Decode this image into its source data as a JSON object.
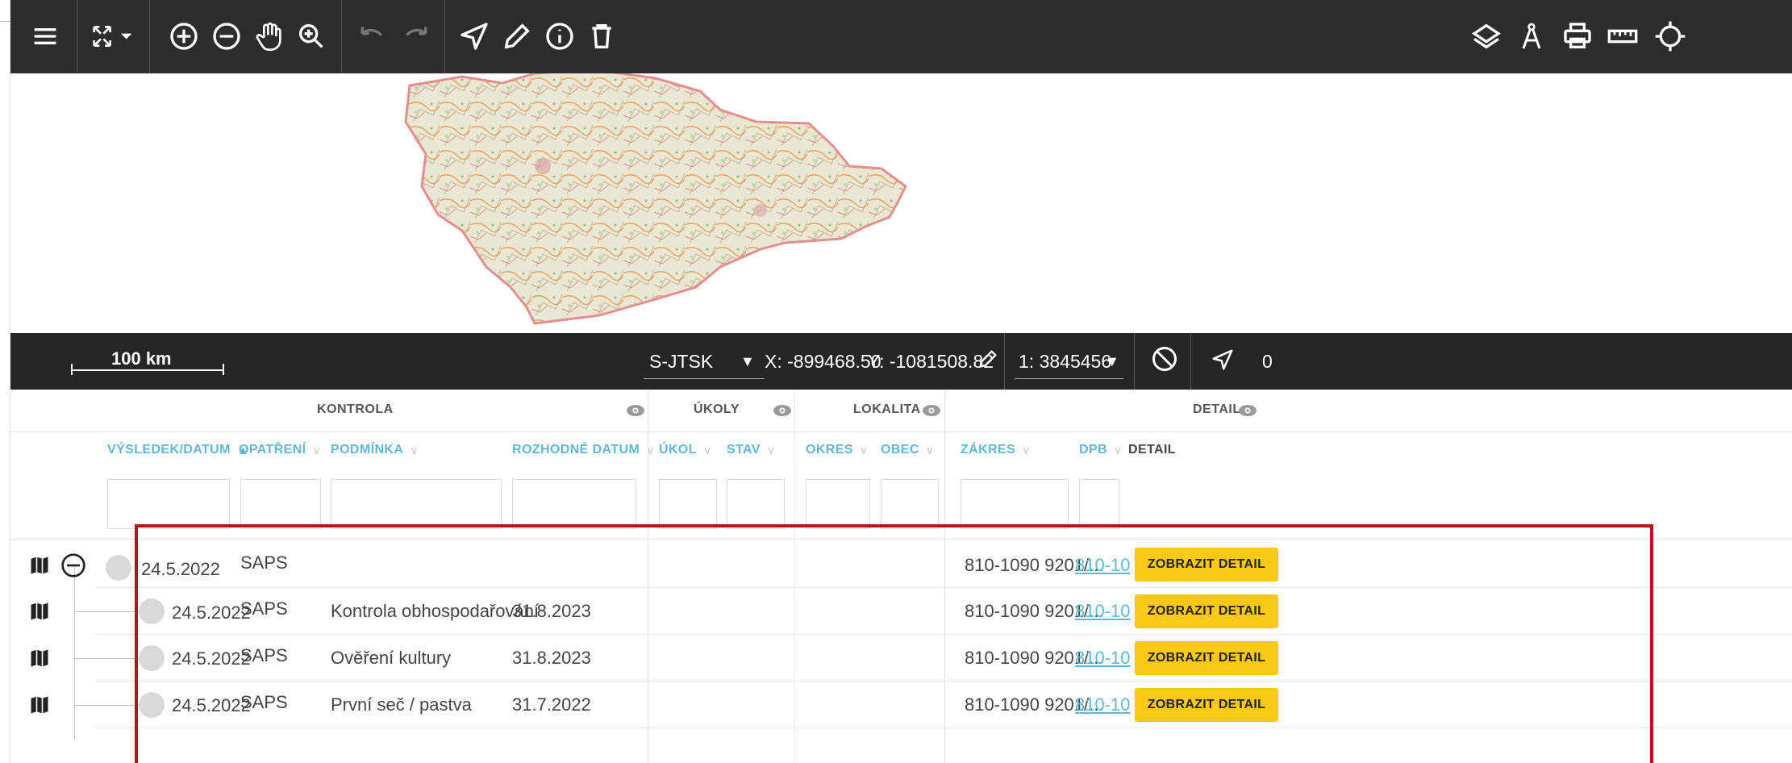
{
  "toolbar": {
    "menu_icon": "hamburger-icon",
    "extent_icon": "zoom-extent-icon",
    "zoom_in_icon": "zoom-in-icon",
    "zoom_out_icon": "zoom-out-icon",
    "pan_icon": "hand-pan-icon",
    "zoom_box_icon": "zoom-box-icon",
    "undo_icon": "undo-icon",
    "redo_icon": "redo-icon",
    "navigate_icon": "navigate-arrow-icon",
    "draw_icon": "pencil-icon",
    "info_icon": "info-icon",
    "delete_icon": "trash-icon",
    "layers_icon": "layers-icon",
    "compass_icon": "compass-icon",
    "print_icon": "printer-icon",
    "measure_icon": "ruler-icon",
    "locate_icon": "locate-icon"
  },
  "statusbar": {
    "scale_label": "100 km",
    "crs": "S-JTSK",
    "x_coord": "X: -899468.50",
    "y_coord": "Y: -1081508.82",
    "map_scale": "1: 3845456",
    "extra_value": "0"
  },
  "table": {
    "groups": {
      "kontrola": "KONTROLA",
      "ukoly": "ÚKOLY",
      "lokalita": "LOKALITA",
      "detail": "DETAIL"
    },
    "columns": {
      "vysledek": "VÝSLEDEK/DATUM",
      "opatreni": "OPATŘENÍ",
      "podminka": "PODMÍNKA",
      "rozhodne": "ROZHODNÉ DATUM",
      "ukol": "ÚKOL",
      "stav": "STAV",
      "okres": "OKRES",
      "obec": "OBEC",
      "zakres": "ZÁKRES",
      "dpb": "DPB",
      "detail": "DETAIL"
    },
    "button_label": "ZOBRAZIT DETAIL",
    "rows": [
      {
        "date": "24.5.2022",
        "measure": "SAPS",
        "condition": "",
        "decisive_date": "",
        "zakres": "810-1090 9201/...",
        "dpb": "810-10"
      },
      {
        "date": "24.5.2022",
        "measure": "SAPS",
        "condition": "Kontrola obhospodařování",
        "decisive_date": "31.8.2023",
        "zakres": "810-1090 9201/...",
        "dpb": "810-10"
      },
      {
        "date": "24.5.2022",
        "measure": "SAPS",
        "condition": "Ověření kultury",
        "decisive_date": "31.8.2023",
        "zakres": "810-1090 9201/...",
        "dpb": "810-10"
      },
      {
        "date": "24.5.2022",
        "measure": "SAPS",
        "condition": "První seč / pastva",
        "decisive_date": "31.7.2022",
        "zakres": "810-1090 9201/...",
        "dpb": "810-10"
      }
    ]
  },
  "colors": {
    "toolbar_bg": "#2d2d2d",
    "status_bg": "#262626",
    "accent_link": "#5fb8d4",
    "button": "#f9c916",
    "highlight": "#b2151b"
  }
}
